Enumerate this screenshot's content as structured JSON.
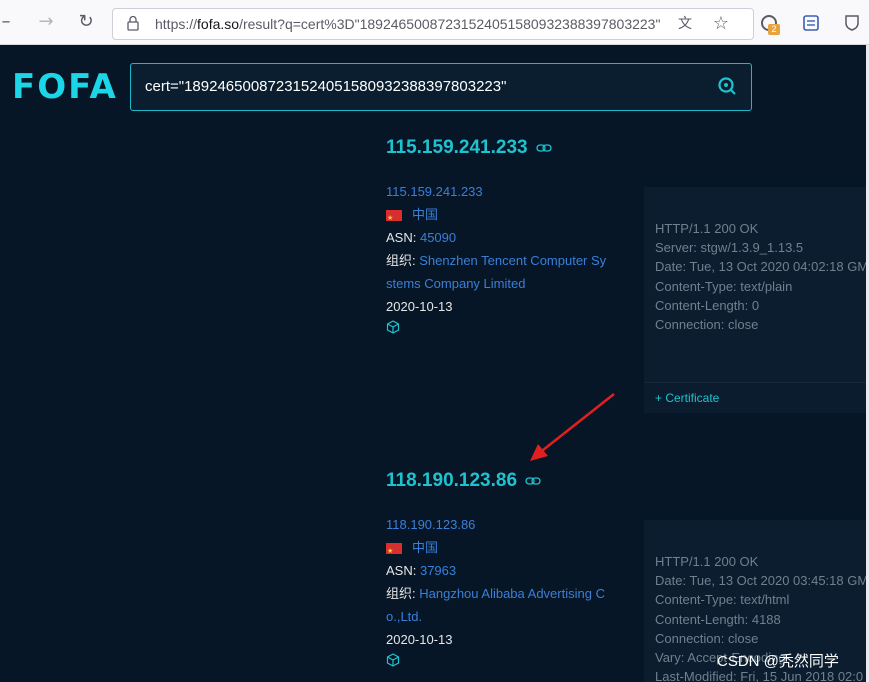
{
  "browser": {
    "url_prefix": "https://",
    "url_host": "fofa.so",
    "url_rest": "/result?q=cert%3D\"18924650087231524051580932388397803223\"",
    "extension_badge": "2",
    "back_icon": "back-arrow-icon",
    "forward_icon": "forward-arrow-icon",
    "reload_icon": "reload-icon"
  },
  "logo": {
    "text": "FOFA",
    "color": "#1bd6e6"
  },
  "search": {
    "query": "cert=\"18924650087231524051580932388397803223\""
  },
  "results": [
    {
      "ip_title": "115.159.241.233",
      "ip_link": "115.159.241.233",
      "country": "中国",
      "asn_label": "ASN: ",
      "asn": "45090",
      "org_label": "组织: ",
      "org_line1": "Shenzhen Tencent Computer Sy",
      "org_line2": "stems Company Limited",
      "date": "2020-10-13",
      "http_lines": [
        "HTTP/1.1 200 OK",
        "Server: stgw/1.3.9_1.13.5",
        "Date: Tue, 13 Oct 2020 04:02:18 GM",
        "Content-Type: text/plain",
        "Content-Length: 0",
        "Connection: close"
      ],
      "cert_label": "+ Certificate"
    },
    {
      "ip_title": "118.190.123.86",
      "ip_link": "118.190.123.86",
      "country": "中国",
      "asn_label": "ASN: ",
      "asn": "37963",
      "org_label": "组织: ",
      "org_line1": "Hangzhou Alibaba Advertising C",
      "org_line2": "o.,Ltd.",
      "date": "2020-10-13",
      "http_lines": [
        "HTTP/1.1 200 OK",
        "Date: Tue, 13 Oct 2020 03:45:18 GM",
        "Content-Type: text/html",
        "Content-Length: 4188",
        "Connection: close",
        "Vary: Accept-Encoding",
        "Last-Modified: Fri, 15 Jun 2018 02:0"
      ]
    }
  ],
  "watermark": "CSDN @秃然同学",
  "colors": {
    "page_bg": "#071626",
    "accent": "#1fc3cf",
    "link": "#3a7fd8",
    "arrow": "#e02020"
  }
}
